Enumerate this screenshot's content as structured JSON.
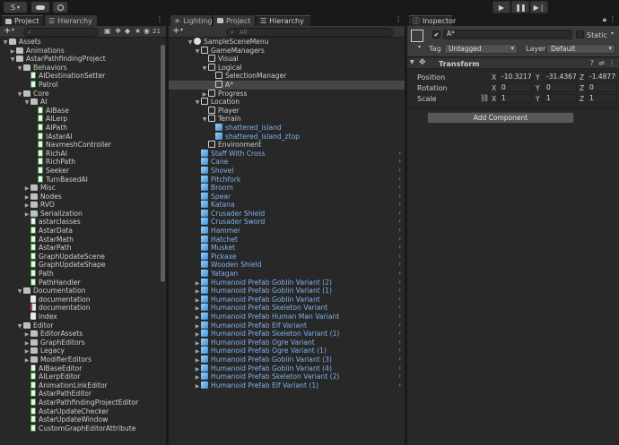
{
  "toolbar": {
    "account_label": "S",
    "play_icon": "play-icon",
    "pause_icon": "pause-icon",
    "step_icon": "step-icon"
  },
  "project_pane": {
    "tabs": [
      {
        "label": "Project"
      },
      {
        "label": "Hierarchy"
      }
    ],
    "add_label": "+",
    "badge_count": "21",
    "tree": [
      {
        "label": "Assets",
        "depth": 0,
        "arrow": "▼",
        "icon": "folder"
      },
      {
        "label": "Animations",
        "depth": 1,
        "arrow": "▶",
        "icon": "folder"
      },
      {
        "label": "AstarPathfindingProject",
        "depth": 1,
        "arrow": "▼",
        "icon": "folder"
      },
      {
        "label": "Behaviors",
        "depth": 2,
        "arrow": "▼",
        "icon": "folder"
      },
      {
        "label": "AIDestinationSetter",
        "depth": 3,
        "arrow": "",
        "icon": "script"
      },
      {
        "label": "Patrol",
        "depth": 3,
        "arrow": "",
        "icon": "script"
      },
      {
        "label": "Core",
        "depth": 2,
        "arrow": "▼",
        "icon": "folder"
      },
      {
        "label": "AI",
        "depth": 3,
        "arrow": "▼",
        "icon": "folder"
      },
      {
        "label": "AIBase",
        "depth": 4,
        "arrow": "",
        "icon": "script"
      },
      {
        "label": "AILerp",
        "depth": 4,
        "arrow": "",
        "icon": "script"
      },
      {
        "label": "AIPath",
        "depth": 4,
        "arrow": "",
        "icon": "script"
      },
      {
        "label": "IAstarAI",
        "depth": 4,
        "arrow": "",
        "icon": "script"
      },
      {
        "label": "NavmeshController",
        "depth": 4,
        "arrow": "",
        "icon": "script"
      },
      {
        "label": "RichAI",
        "depth": 4,
        "arrow": "",
        "icon": "script"
      },
      {
        "label": "RichPath",
        "depth": 4,
        "arrow": "",
        "icon": "script"
      },
      {
        "label": "Seeker",
        "depth": 4,
        "arrow": "",
        "icon": "script"
      },
      {
        "label": "TurnBasedAI",
        "depth": 4,
        "arrow": "",
        "icon": "script"
      },
      {
        "label": "Misc",
        "depth": 3,
        "arrow": "▶",
        "icon": "folder"
      },
      {
        "label": "Nodes",
        "depth": 3,
        "arrow": "▶",
        "icon": "folder"
      },
      {
        "label": "RVO",
        "depth": 3,
        "arrow": "▶",
        "icon": "folder"
      },
      {
        "label": "Serialization",
        "depth": 3,
        "arrow": "▶",
        "icon": "folder"
      },
      {
        "label": "astarclasses",
        "depth": 3,
        "arrow": "",
        "icon": "script"
      },
      {
        "label": "AstarData",
        "depth": 3,
        "arrow": "",
        "icon": "script"
      },
      {
        "label": "AstarMath",
        "depth": 3,
        "arrow": "",
        "icon": "script"
      },
      {
        "label": "AstarPath",
        "depth": 3,
        "arrow": "",
        "icon": "script"
      },
      {
        "label": "GraphUpdateScene",
        "depth": 3,
        "arrow": "",
        "icon": "script"
      },
      {
        "label": "GraphUpdateShape",
        "depth": 3,
        "arrow": "",
        "icon": "script"
      },
      {
        "label": "Path",
        "depth": 3,
        "arrow": "",
        "icon": "script"
      },
      {
        "label": "PathHandler",
        "depth": 3,
        "arrow": "",
        "icon": "script"
      },
      {
        "label": "Documentation",
        "depth": 2,
        "arrow": "▼",
        "icon": "folder"
      },
      {
        "label": "documentation",
        "depth": 3,
        "arrow": "",
        "icon": "doc"
      },
      {
        "label": "documentation",
        "depth": 3,
        "arrow": "",
        "icon": "pdf"
      },
      {
        "label": "index",
        "depth": 3,
        "arrow": "",
        "icon": "doc"
      },
      {
        "label": "Editor",
        "depth": 2,
        "arrow": "▼",
        "icon": "folder"
      },
      {
        "label": "EditorAssets",
        "depth": 3,
        "arrow": "▶",
        "icon": "folder"
      },
      {
        "label": "GraphEditors",
        "depth": 3,
        "arrow": "▶",
        "icon": "folder"
      },
      {
        "label": "Legacy",
        "depth": 3,
        "arrow": "▶",
        "icon": "folder"
      },
      {
        "label": "ModifierEditors",
        "depth": 3,
        "arrow": "▶",
        "icon": "folder"
      },
      {
        "label": "AIBaseEditor",
        "depth": 3,
        "arrow": "",
        "icon": "script"
      },
      {
        "label": "AILerpEditor",
        "depth": 3,
        "arrow": "",
        "icon": "script"
      },
      {
        "label": "AnimationLinkEditor",
        "depth": 3,
        "arrow": "",
        "icon": "script"
      },
      {
        "label": "AstarPathEditor",
        "depth": 3,
        "arrow": "",
        "icon": "script"
      },
      {
        "label": "AstarPathfindingProjectEditor",
        "depth": 3,
        "arrow": "",
        "icon": "script"
      },
      {
        "label": "AstarUpdateChecker",
        "depth": 3,
        "arrow": "",
        "icon": "script"
      },
      {
        "label": "AstarUpdateWindow",
        "depth": 3,
        "arrow": "",
        "icon": "script"
      },
      {
        "label": "CustomGraphEditorAttribute",
        "depth": 3,
        "arrow": "",
        "icon": "script"
      }
    ]
  },
  "hierarchy_pane": {
    "tabs": [
      {
        "label": "Lighting"
      },
      {
        "label": "Project"
      },
      {
        "label": "Hierarchy"
      }
    ],
    "add_label": "+",
    "search_placeholder": "All",
    "tree": [
      {
        "label": "SampleSceneMenu",
        "depth": 0,
        "arrow": "▼",
        "icon": "scene",
        "blue": false,
        "chev": false,
        "sel": false
      },
      {
        "label": "GameManagers",
        "depth": 1,
        "arrow": "▼",
        "icon": "gobj",
        "blue": false,
        "chev": false,
        "sel": false
      },
      {
        "label": "Visual",
        "depth": 2,
        "arrow": "",
        "icon": "gobj",
        "blue": false,
        "chev": false,
        "sel": false
      },
      {
        "label": "Logical",
        "depth": 2,
        "arrow": "▼",
        "icon": "gobj",
        "blue": false,
        "chev": false,
        "sel": false
      },
      {
        "label": "SelectionManager",
        "depth": 3,
        "arrow": "",
        "icon": "gobj",
        "blue": false,
        "chev": false,
        "sel": false
      },
      {
        "label": "A*",
        "depth": 3,
        "arrow": "",
        "icon": "gobj",
        "blue": false,
        "chev": false,
        "sel": true
      },
      {
        "label": "Progress",
        "depth": 2,
        "arrow": "▶",
        "icon": "gobj",
        "blue": false,
        "chev": false,
        "sel": false
      },
      {
        "label": "Location",
        "depth": 1,
        "arrow": "▼",
        "icon": "gobj",
        "blue": false,
        "chev": false,
        "sel": false
      },
      {
        "label": "Player",
        "depth": 2,
        "arrow": "",
        "icon": "gobj",
        "blue": false,
        "chev": false,
        "sel": false
      },
      {
        "label": "Terrain",
        "depth": 2,
        "arrow": "▼",
        "icon": "gobj",
        "blue": false,
        "chev": false,
        "sel": false
      },
      {
        "label": "shattered_island",
        "depth": 3,
        "arrow": "",
        "icon": "cube",
        "blue": true,
        "chev": false,
        "sel": false
      },
      {
        "label": "shattered_island_ztop",
        "depth": 3,
        "arrow": "",
        "icon": "cube",
        "blue": true,
        "chev": false,
        "sel": false
      },
      {
        "label": "Environment",
        "depth": 2,
        "arrow": "",
        "icon": "gobj",
        "blue": false,
        "chev": false,
        "sel": false
      },
      {
        "label": "Staff With Cross",
        "depth": 1,
        "arrow": "",
        "icon": "cube",
        "blue": true,
        "chev": true,
        "sel": false
      },
      {
        "label": "Cane",
        "depth": 1,
        "arrow": "",
        "icon": "cube",
        "blue": true,
        "chev": true,
        "sel": false
      },
      {
        "label": "Shovel",
        "depth": 1,
        "arrow": "",
        "icon": "cube",
        "blue": true,
        "chev": true,
        "sel": false
      },
      {
        "label": "Pitchfork",
        "depth": 1,
        "arrow": "",
        "icon": "cube",
        "blue": true,
        "chev": true,
        "sel": false
      },
      {
        "label": "Broom",
        "depth": 1,
        "arrow": "",
        "icon": "cube",
        "blue": true,
        "chev": true,
        "sel": false
      },
      {
        "label": "Spear",
        "depth": 1,
        "arrow": "",
        "icon": "cube",
        "blue": true,
        "chev": true,
        "sel": false
      },
      {
        "label": "Katana",
        "depth": 1,
        "arrow": "",
        "icon": "cube",
        "blue": true,
        "chev": true,
        "sel": false
      },
      {
        "label": "Crusader Shield",
        "depth": 1,
        "arrow": "",
        "icon": "cube",
        "blue": true,
        "chev": true,
        "sel": false
      },
      {
        "label": "Crusader Sword",
        "depth": 1,
        "arrow": "",
        "icon": "cube",
        "blue": true,
        "chev": true,
        "sel": false
      },
      {
        "label": "Hammer",
        "depth": 1,
        "arrow": "",
        "icon": "cube",
        "blue": true,
        "chev": true,
        "sel": false
      },
      {
        "label": "Hatchet",
        "depth": 1,
        "arrow": "",
        "icon": "cube",
        "blue": true,
        "chev": true,
        "sel": false
      },
      {
        "label": "Musket",
        "depth": 1,
        "arrow": "",
        "icon": "cube",
        "blue": true,
        "chev": true,
        "sel": false
      },
      {
        "label": "Pickaxe",
        "depth": 1,
        "arrow": "",
        "icon": "cube",
        "blue": true,
        "chev": true,
        "sel": false
      },
      {
        "label": "Wooden Shield",
        "depth": 1,
        "arrow": "",
        "icon": "cube",
        "blue": true,
        "chev": true,
        "sel": false
      },
      {
        "label": "Yatagan",
        "depth": 1,
        "arrow": "",
        "icon": "cube",
        "blue": true,
        "chev": true,
        "sel": false
      },
      {
        "label": "Humanoid Prefab Goblin Variant (2)",
        "depth": 1,
        "arrow": "▶",
        "icon": "cube",
        "blue": true,
        "chev": true,
        "sel": false
      },
      {
        "label": "Humanoid Prefab Goblin Variant (1)",
        "depth": 1,
        "arrow": "▶",
        "icon": "cube",
        "blue": true,
        "chev": true,
        "sel": false
      },
      {
        "label": "Humanoid Prefab Goblin Variant",
        "depth": 1,
        "arrow": "▶",
        "icon": "cube",
        "blue": true,
        "chev": true,
        "sel": false
      },
      {
        "label": "Humanoid Prefab Skeleton Variant",
        "depth": 1,
        "arrow": "▶",
        "icon": "cube",
        "blue": true,
        "chev": true,
        "sel": false
      },
      {
        "label": "Humanoid Prefab Human Man Variant",
        "depth": 1,
        "arrow": "▶",
        "icon": "cube",
        "blue": true,
        "chev": true,
        "sel": false
      },
      {
        "label": "Humanoid Prefab Elf Variant",
        "depth": 1,
        "arrow": "▶",
        "icon": "cube",
        "blue": true,
        "chev": true,
        "sel": false
      },
      {
        "label": "Humanoid Prefab Skeleton Variant (1)",
        "depth": 1,
        "arrow": "▶",
        "icon": "cube",
        "blue": true,
        "chev": true,
        "sel": false
      },
      {
        "label": "Humanoid Prefab Ogre Variant",
        "depth": 1,
        "arrow": "▶",
        "icon": "cube",
        "blue": true,
        "chev": true,
        "sel": false
      },
      {
        "label": "Humanoid Prefab Ogre Variant (1)",
        "depth": 1,
        "arrow": "▶",
        "icon": "cube",
        "blue": true,
        "chev": true,
        "sel": false
      },
      {
        "label": "Humanoid Prefab Goblin Variant (3)",
        "depth": 1,
        "arrow": "▶",
        "icon": "cube",
        "blue": true,
        "chev": true,
        "sel": false
      },
      {
        "label": "Humanoid Prefab Goblin Variant (4)",
        "depth": 1,
        "arrow": "▶",
        "icon": "cube",
        "blue": true,
        "chev": true,
        "sel": false
      },
      {
        "label": "Humanoid Prefab Skeleton Variant (2)",
        "depth": 1,
        "arrow": "▶",
        "icon": "cube",
        "blue": true,
        "chev": true,
        "sel": false
      },
      {
        "label": "Humanoid Prefab Elf Variant (1)",
        "depth": 1,
        "arrow": "▶",
        "icon": "cube",
        "blue": true,
        "chev": true,
        "sel": false
      }
    ]
  },
  "inspector": {
    "tab_label": "Inspector",
    "object_name": "A*",
    "static_label": "Static",
    "tag_label": "Tag",
    "tag_value": "Untagged",
    "layer_label": "Layer",
    "layer_value": "Default",
    "transform_label": "Transform",
    "position_label": "Position",
    "rotation_label": "Rotation",
    "scale_label": "Scale",
    "axis_x": "X",
    "axis_y": "Y",
    "axis_z": "Z",
    "position": {
      "x": "-10.32176",
      "y": "-31.4367",
      "z": "-1.48779!"
    },
    "rotation": {
      "x": "0",
      "y": "0",
      "z": "0"
    },
    "scale": {
      "x": "1",
      "y": "1",
      "z": "1"
    },
    "add_component_label": "Add Component",
    "accent": "#3b6ea8"
  }
}
